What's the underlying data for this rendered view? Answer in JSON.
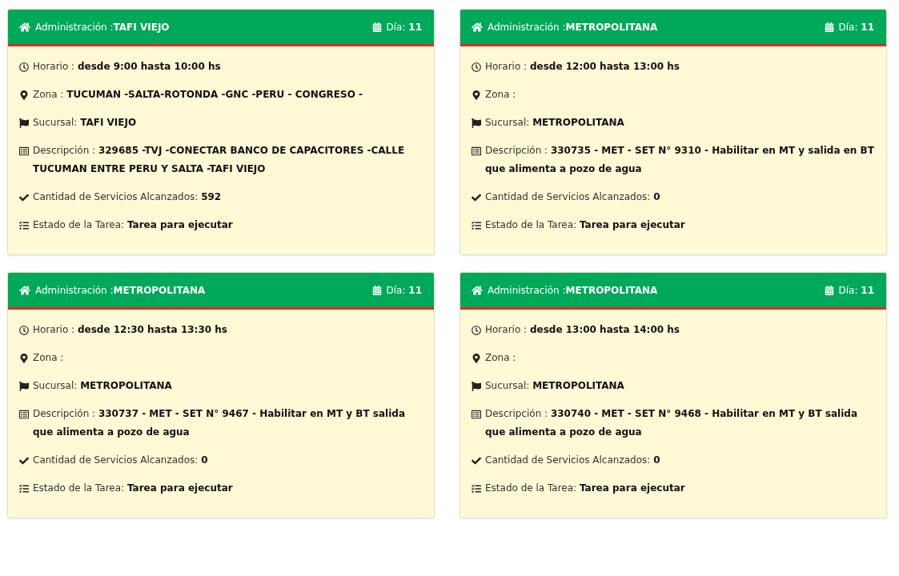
{
  "cards": [
    {
      "header": {
        "title": "Administración :**TAFI VIEJO**",
        "day": "Día: **11**"
      },
      "fields": [
        {
          "kind": "clock",
          "text": "Horario : **desde 9:00 hasta 10:00 hs**"
        },
        {
          "kind": "pin",
          "text": "Zona : **TUCUMAN -SALTA-ROTONDA -GNC -PERU - CONGRESO -**"
        },
        {
          "kind": "flag",
          "text": "Sucursal: **TAFI VIEJO**"
        },
        {
          "kind": "list",
          "text": "Descripción : **329685 -TVJ -CONECTAR BANCO DE CAPACITORES -CALLE TUCUMAN ENTRE PERU Y SALTA -TAFI VIEJO**"
        },
        {
          "kind": "check",
          "text": "Cantidad de Servicios Alcanzados: **592**"
        },
        {
          "kind": "tasks",
          "text": "Estado de la Tarea: **Tarea para ejecutar**"
        }
      ]
    },
    {
      "header": {
        "title": "Administración :**METROPOLITANA**",
        "day": "Día: **11**"
      },
      "fields": [
        {
          "kind": "clock",
          "text": "Horario : **desde 12:00 hasta 13:00 hs**"
        },
        {
          "kind": "pin",
          "text": "Zona :"
        },
        {
          "kind": "flag",
          "text": "Sucursal: **METROPOLITANA**"
        },
        {
          "kind": "list",
          "text": "Descripción : **330735 - MET - SET N° 9310 - Habilitar en MT y salida en BT que alimenta a pozo de agua**"
        },
        {
          "kind": "check",
          "text": "Cantidad de Servicios Alcanzados: **0**"
        },
        {
          "kind": "tasks",
          "text": "Estado de la Tarea: **Tarea para ejecutar**"
        }
      ]
    },
    {
      "header": {
        "title": "Administración :**METROPOLITANA**",
        "day": "Día: **11**"
      },
      "fields": [
        {
          "kind": "clock",
          "text": "Horario : **desde 12:30 hasta 13:30 hs**"
        },
        {
          "kind": "pin",
          "text": "Zona :"
        },
        {
          "kind": "flag",
          "text": "Sucursal: **METROPOLITANA**"
        },
        {
          "kind": "list",
          "text": "Descripción : **330737 - MET - SET N° 9467 - Habilitar en MT y BT salida que alimenta a pozo de agua**"
        },
        {
          "kind": "check",
          "text": "Cantidad de Servicios Alcanzados: **0**"
        },
        {
          "kind": "tasks",
          "text": "Estado de la Tarea: **Tarea para ejecutar**"
        }
      ]
    },
    {
      "header": {
        "title": "Administración :**METROPOLITANA**",
        "day": "Día: **11**"
      },
      "fields": [
        {
          "kind": "clock",
          "text": "Horario : **desde 13:00 hasta 14:00 hs**"
        },
        {
          "kind": "pin",
          "text": "Zona :"
        },
        {
          "kind": "flag",
          "text": "Sucursal: **METROPOLITANA**"
        },
        {
          "kind": "list",
          "text": "Descripción : **330740 - MET - SET N° 9468 - Habilitar en MT y BT salida que alimenta a pozo de agua**"
        },
        {
          "kind": "check",
          "text": "Cantidad de Servicios Alcanzados: **0**"
        },
        {
          "kind": "tasks",
          "text": "Estado de la Tarea: **Tarea para ejecutar**"
        }
      ]
    }
  ]
}
